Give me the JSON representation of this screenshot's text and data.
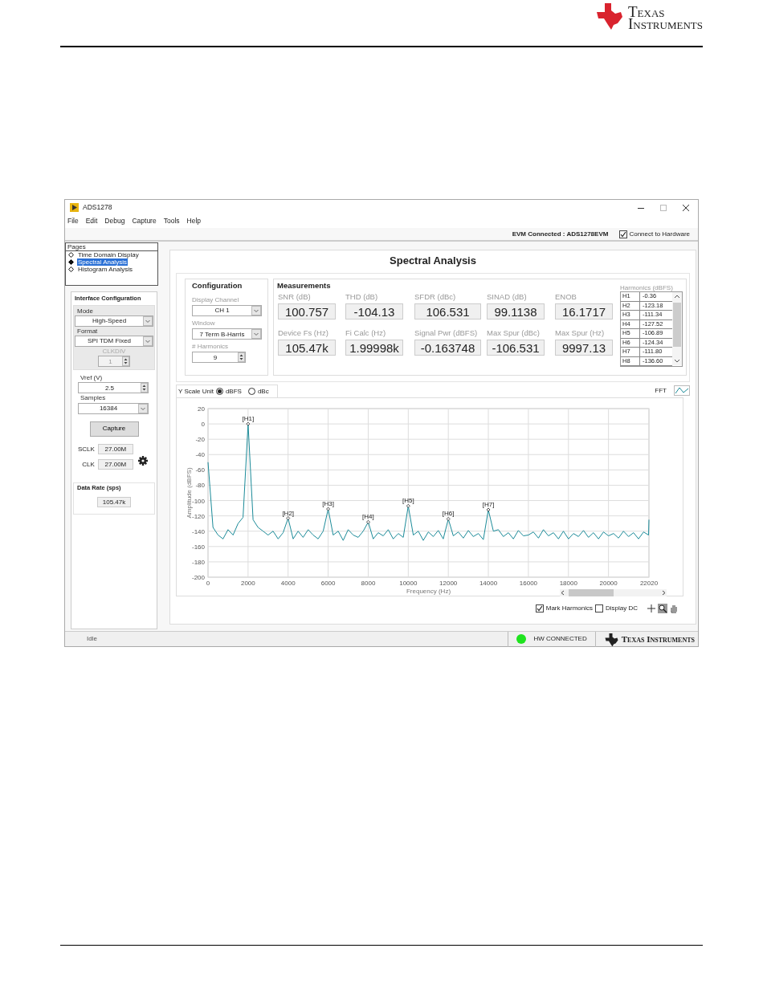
{
  "logo": {
    "line1": "Texas",
    "line2": "Instruments"
  },
  "window": {
    "title": "ADS1278"
  },
  "menu": [
    "File",
    "Edit",
    "Debug",
    "Capture",
    "Tools",
    "Help"
  ],
  "connection": {
    "label": "EVM Connected : ADS1278EVM",
    "checkbox": {
      "label": "Connect to Hardware",
      "checked": true
    }
  },
  "pages": {
    "title": "Pages",
    "items": [
      {
        "label": "Time Domain Display",
        "selected": false
      },
      {
        "label": "Spectral Analysis",
        "selected": true
      },
      {
        "label": "Histogram Analysis",
        "selected": false
      }
    ]
  },
  "interface_config": {
    "title": "Interface Configuration",
    "mode": {
      "label": "Mode",
      "value": "High-Speed"
    },
    "format": {
      "label": "Format",
      "value": "SPI TDM Fixed"
    },
    "clkdiv": {
      "label": "CLKDIV",
      "value": "1",
      "disabled": true
    },
    "vref": {
      "label": "Vref (V)",
      "value": "2.5"
    },
    "samples": {
      "label": "Samples",
      "value": "16384"
    },
    "capture_button": "Capture",
    "sclk": {
      "label": "SCLK",
      "value": "27.00M"
    },
    "clk": {
      "label": "CLK",
      "value": "27.00M"
    },
    "data_rate": {
      "title": "Data Rate (sps)",
      "value": "105.47k"
    }
  },
  "page_title": "Spectral Analysis",
  "configuration": {
    "title": "Configuration",
    "display_channel": {
      "label": "Display Channel",
      "value": "CH 1"
    },
    "window": {
      "label": "Window",
      "value": "7 Term B-Harris"
    },
    "harmonics": {
      "label": "# Harmonics",
      "value": "9"
    }
  },
  "measurements": {
    "title": "Measurements",
    "items": [
      {
        "label": "SNR (dB)",
        "value": "100.757"
      },
      {
        "label": "THD (dB)",
        "value": "-104.13"
      },
      {
        "label": "SFDR (dBc)",
        "value": "106.531"
      },
      {
        "label": "SINAD (dB)",
        "value": "99.1138"
      },
      {
        "label": "ENOB",
        "value": "16.1717"
      },
      {
        "label": "Device Fs (Hz)",
        "value": "105.47k"
      },
      {
        "label": "Fi Calc (Hz)",
        "value": "1.99998k"
      },
      {
        "label": "Signal Pwr (dBFS)",
        "value": "-0.163748"
      },
      {
        "label": "Max Spur (dBc)",
        "value": "-106.531"
      },
      {
        "label": "Max Spur (Hz)",
        "value": "9997.13"
      }
    ]
  },
  "harmonics_table": {
    "title": "Harmonics (dBFS)",
    "rows": [
      {
        "name": "H1",
        "value": "-0.36"
      },
      {
        "name": "H2",
        "value": "-123.18"
      },
      {
        "name": "H3",
        "value": "-111.34"
      },
      {
        "name": "H4",
        "value": "-127.52"
      },
      {
        "name": "H5",
        "value": "-106.89"
      },
      {
        "name": "H6",
        "value": "-124.34"
      },
      {
        "name": "H7",
        "value": "-111.80"
      },
      {
        "name": "H8",
        "value": "-136.60"
      }
    ]
  },
  "y_scale": {
    "label": "Y Scale Unit",
    "options": [
      {
        "label": "dBFS",
        "selected": true
      },
      {
        "label": "dBc",
        "selected": false
      }
    ]
  },
  "spectrum": {
    "chart_data": {
      "type": "line",
      "grid": true,
      "xlabel": "Frequency (Hz)",
      "ylabel": "Amplitude (dBFS)",
      "xlim": [
        0,
        22020
      ],
      "ylim": [
        -200,
        20
      ],
      "xticks": [
        0,
        2000,
        4000,
        6000,
        8000,
        10000,
        12000,
        14000,
        16000,
        18000,
        20000,
        22020
      ],
      "yticks": [
        -200,
        -180,
        -160,
        -140,
        -120,
        -100,
        -80,
        -60,
        -40,
        -20,
        0,
        20
      ],
      "x": [
        0,
        250,
        500,
        750,
        1000,
        1250,
        1500,
        1750,
        2000,
        2250,
        2500,
        2750,
        3000,
        3250,
        3500,
        3750,
        4000,
        4250,
        4500,
        4750,
        5000,
        5250,
        5500,
        5750,
        6000,
        6250,
        6500,
        6750,
        7000,
        7250,
        7500,
        7750,
        8000,
        8250,
        8500,
        8750,
        9000,
        9250,
        9500,
        9750,
        10000,
        10250,
        10500,
        10750,
        11000,
        11250,
        11500,
        11750,
        12000,
        12250,
        12500,
        12750,
        13000,
        13250,
        13500,
        13750,
        14000,
        14250,
        14500,
        14750,
        15000,
        15250,
        15500,
        15750,
        16000,
        16250,
        16500,
        16750,
        17000,
        17250,
        17500,
        17750,
        18000,
        18250,
        18500,
        18750,
        19000,
        19250,
        19500,
        19750,
        20000,
        20250,
        20500,
        20750,
        21000,
        21250,
        21500,
        21750,
        22000,
        22020
      ],
      "series": [
        {
          "name": "FFT",
          "color": "#1b8b99",
          "values": [
            -50,
            -135,
            -145,
            -150,
            -138,
            -145,
            -130,
            -122,
            0,
            -125,
            -135,
            -140,
            -145,
            -140,
            -150,
            -142,
            -123,
            -150,
            -140,
            -148,
            -138,
            -145,
            -150,
            -140,
            -111,
            -145,
            -140,
            -152,
            -138,
            -145,
            -148,
            -140,
            -128,
            -150,
            -142,
            -146,
            -138,
            -150,
            -143,
            -148,
            -107,
            -145,
            -140,
            -152,
            -141,
            -147,
            -139,
            -150,
            -124,
            -146,
            -141,
            -149,
            -139,
            -147,
            -143,
            -151,
            -112,
            -140,
            -138,
            -147,
            -142,
            -150,
            -139,
            -146,
            -145,
            -141,
            -149,
            -138,
            -146,
            -142,
            -150,
            -140,
            -150,
            -143,
            -147,
            -139,
            -148,
            -142,
            -150,
            -141,
            -146,
            -143,
            -149,
            -140,
            -147,
            -142,
            -150,
            -141,
            -145,
            -125
          ]
        }
      ],
      "annotations": [
        {
          "x": 2000,
          "y": 0,
          "text": "[H1]"
        },
        {
          "x": 4000,
          "y": -123,
          "text": "[H2]"
        },
        {
          "x": 6000,
          "y": -111,
          "text": "[H3]"
        },
        {
          "x": 8000,
          "y": -128,
          "text": "[H4]"
        },
        {
          "x": 10000,
          "y": -107,
          "text": "[H5]"
        },
        {
          "x": 12000,
          "y": -124,
          "text": "[H6]"
        },
        {
          "x": 14000,
          "y": -112,
          "text": "[H7]"
        }
      ]
    }
  },
  "display_options": [
    {
      "label": "Mark Harmonics",
      "checked": true
    },
    {
      "label": "Display DC",
      "checked": false
    }
  ],
  "status_bar": {
    "status": "Idle",
    "hw_connected": true,
    "hw_status": "HW CONNECTED",
    "logo_text": "Texas Instruments"
  }
}
